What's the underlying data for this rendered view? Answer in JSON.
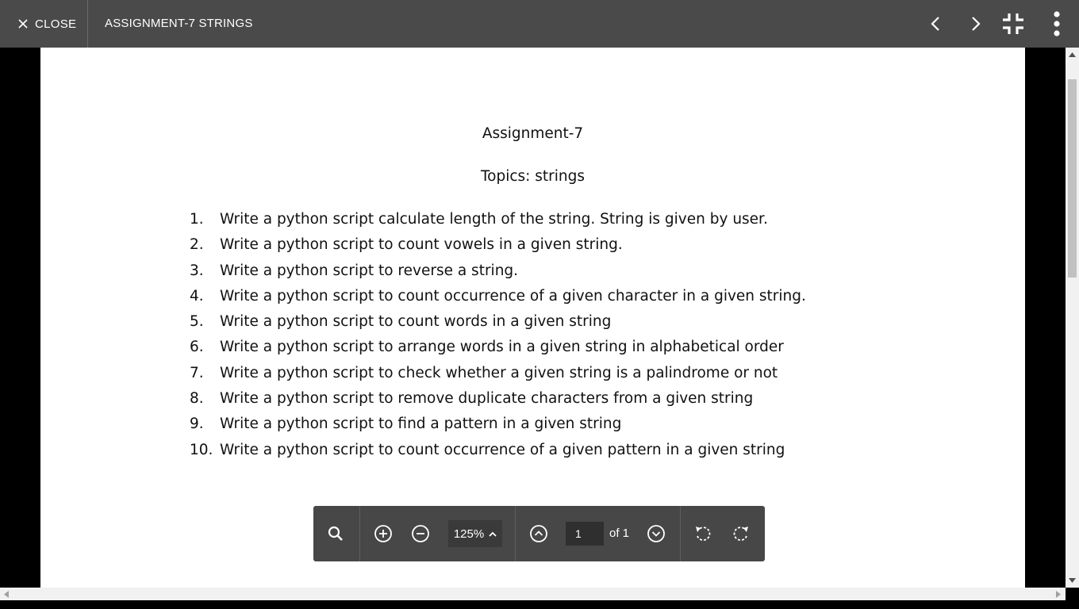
{
  "topbar": {
    "close_label": "CLOSE",
    "doc_title": "ASSIGNMENT-7 STRINGS",
    "icons": [
      "close-icon",
      "chevron-left-icon",
      "chevron-right-icon",
      "exit-fullscreen-icon",
      "more-vert-icon"
    ]
  },
  "document": {
    "title": "Assignment-7",
    "subtitle": "Topics: strings",
    "questions": [
      {
        "num": "1.",
        "text": "Write a python script calculate length of the string. String is given by user."
      },
      {
        "num": "2.",
        "text": "Write a python script to count vowels in a given string."
      },
      {
        "num": "3.",
        "text": "Write a python script to reverse a string."
      },
      {
        "num": "4.",
        "text": "Write a python script to count occurrence of a given character in a given string."
      },
      {
        "num": "5.",
        "text": "Write a python script to count words in a given string"
      },
      {
        "num": "6.",
        "text": "Write a python script to arrange words in a given string in alphabetical order"
      },
      {
        "num": "7.",
        "text": "Write a python script to check whether a given string is a palindrome or not"
      },
      {
        "num": "8.",
        "text": "Write a python script to remove duplicate characters from a given string"
      },
      {
        "num": "9.",
        "text": "Write a python script to find a pattern in a given string"
      },
      {
        "num": "10.",
        "text": "Write a python script to count occurrence of a given pattern in a given string"
      }
    ]
  },
  "pdf_toolbar": {
    "zoom": "125%",
    "page_current": "1",
    "page_total_label": "of 1",
    "icons": [
      "search-icon",
      "zoom-in-icon",
      "zoom-out-icon",
      "chevron-up-icon",
      "previous-page-icon",
      "next-page-icon",
      "rotate-left-icon",
      "rotate-right-icon"
    ]
  },
  "colors": {
    "topbar": "#4a4a4a",
    "pdf_toolbar": "#474747",
    "page": "#ffffff",
    "background": "#000000"
  }
}
